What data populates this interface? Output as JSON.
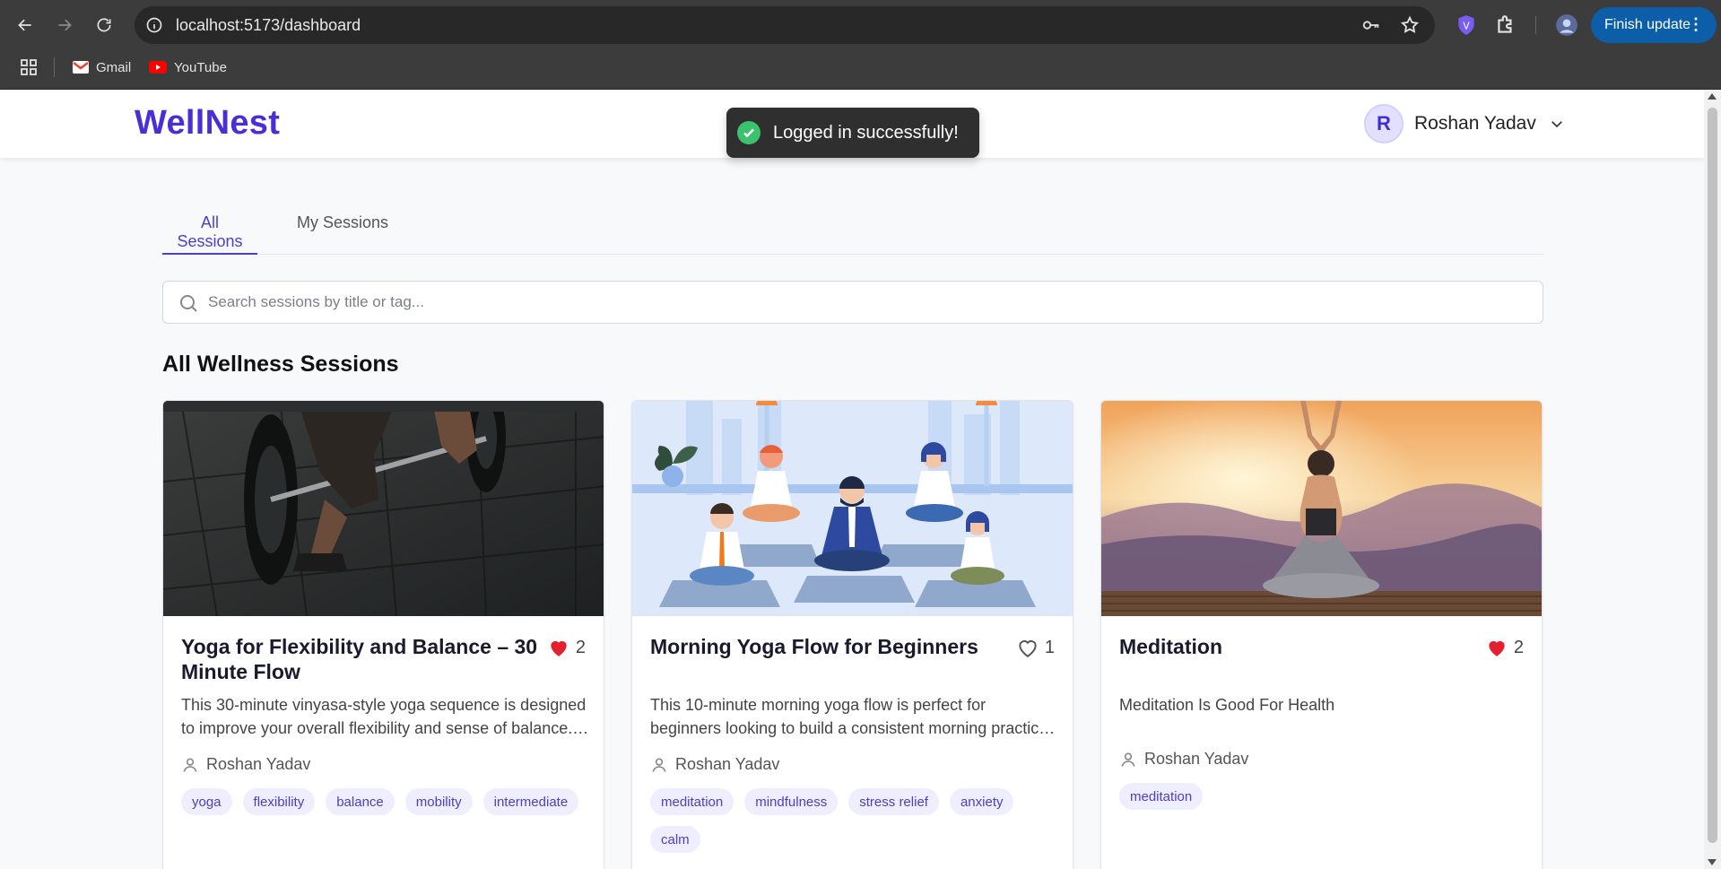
{
  "browser": {
    "url": "localhost:5173/dashboard",
    "finish_update_label": "Finish update",
    "bookmarks": [
      {
        "label": "Gmail",
        "icon": "gmail-icon"
      },
      {
        "label": "YouTube",
        "icon": "youtube-icon"
      }
    ]
  },
  "header": {
    "logo": "WellNest",
    "avatar_initial": "R",
    "user_name": "Roshan Yadav"
  },
  "toast": {
    "message": "Logged in successfully!",
    "color": "#3cc26f"
  },
  "tabs": [
    {
      "label": "All Sessions",
      "active": true
    },
    {
      "label": "My Sessions",
      "active": false
    }
  ],
  "search": {
    "placeholder": "Search sessions by title or tag..."
  },
  "section_title": "All Wellness Sessions",
  "colors": {
    "brand": "#4a2fd6",
    "tab_active": "#4a3fd0",
    "tag_bg": "#efeefe",
    "heart": "#e5202e"
  },
  "sessions": [
    {
      "title": "Yoga for Flexibility and Balance – 30 Minute Flow",
      "likes": "2",
      "liked": true,
      "description": "This 30-minute vinyasa-style yoga sequence is designed to improve your overall flexibility and sense of balance. It blends gentle movement with focused breathing.",
      "author": "Roshan Yadav",
      "tags": [
        "yoga",
        "flexibility",
        "balance",
        "mobility",
        "intermediate"
      ]
    },
    {
      "title": "Morning Yoga Flow for Beginners",
      "likes": "1",
      "liked": false,
      "description": "This 10-minute morning yoga flow is perfect for beginners looking to build a consistent morning practice. The routine gently wakes up the body.",
      "author": "Roshan Yadav",
      "tags": [
        "meditation",
        "mindfulness",
        "stress relief",
        "anxiety",
        "calm"
      ]
    },
    {
      "title": "Meditation",
      "likes": "2",
      "liked": true,
      "description": "Meditation Is Good For Health",
      "author": "Roshan Yadav",
      "tags": [
        "meditation"
      ]
    }
  ]
}
